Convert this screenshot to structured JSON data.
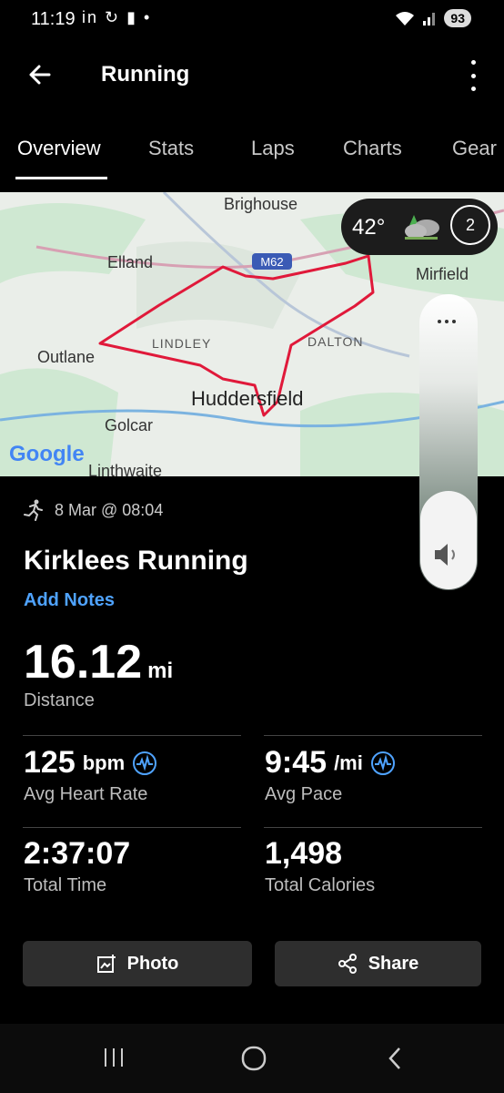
{
  "status_bar": {
    "time": "11:19",
    "left_icons": "in ↻ ▮ •",
    "battery": "93"
  },
  "app_bar": {
    "title": "Running"
  },
  "tabs": [
    {
      "label": "Overview",
      "active": true
    },
    {
      "label": "Stats"
    },
    {
      "label": "Laps"
    },
    {
      "label": "Charts"
    },
    {
      "label": "Gear"
    }
  ],
  "map": {
    "labels": {
      "brighouse": "Brighouse",
      "elland": "Elland",
      "mirfield": "Mirfield",
      "outlane": "Outlane",
      "lindley": "LINDLEY",
      "dalton": "DALTON",
      "huddersfield": "Huddersfield",
      "golcar": "Golcar",
      "linthwaite": "Linthwaite",
      "m62": "M62",
      "google": "Google"
    },
    "route_color": "#e0193a"
  },
  "weather": {
    "temperature": "42°",
    "badge": "2"
  },
  "activity": {
    "datetime": "8 Mar @ 08:04",
    "title": "Kirklees Running",
    "add_notes": "Add Notes",
    "distance_value": "16.12",
    "distance_unit": "mi",
    "distance_label": "Distance"
  },
  "stats": {
    "heart_rate": {
      "value": "125",
      "unit": "bpm",
      "label": "Avg Heart Rate"
    },
    "pace": {
      "value": "9:45",
      "unit": "/mi",
      "label": "Avg Pace"
    },
    "time": {
      "value": "2:37:07",
      "label": "Total Time"
    },
    "calories": {
      "value": "1,498",
      "label": "Total Calories"
    }
  },
  "buttons": {
    "photo": "Photo",
    "share": "Share"
  },
  "accent": "#4fa3ff"
}
